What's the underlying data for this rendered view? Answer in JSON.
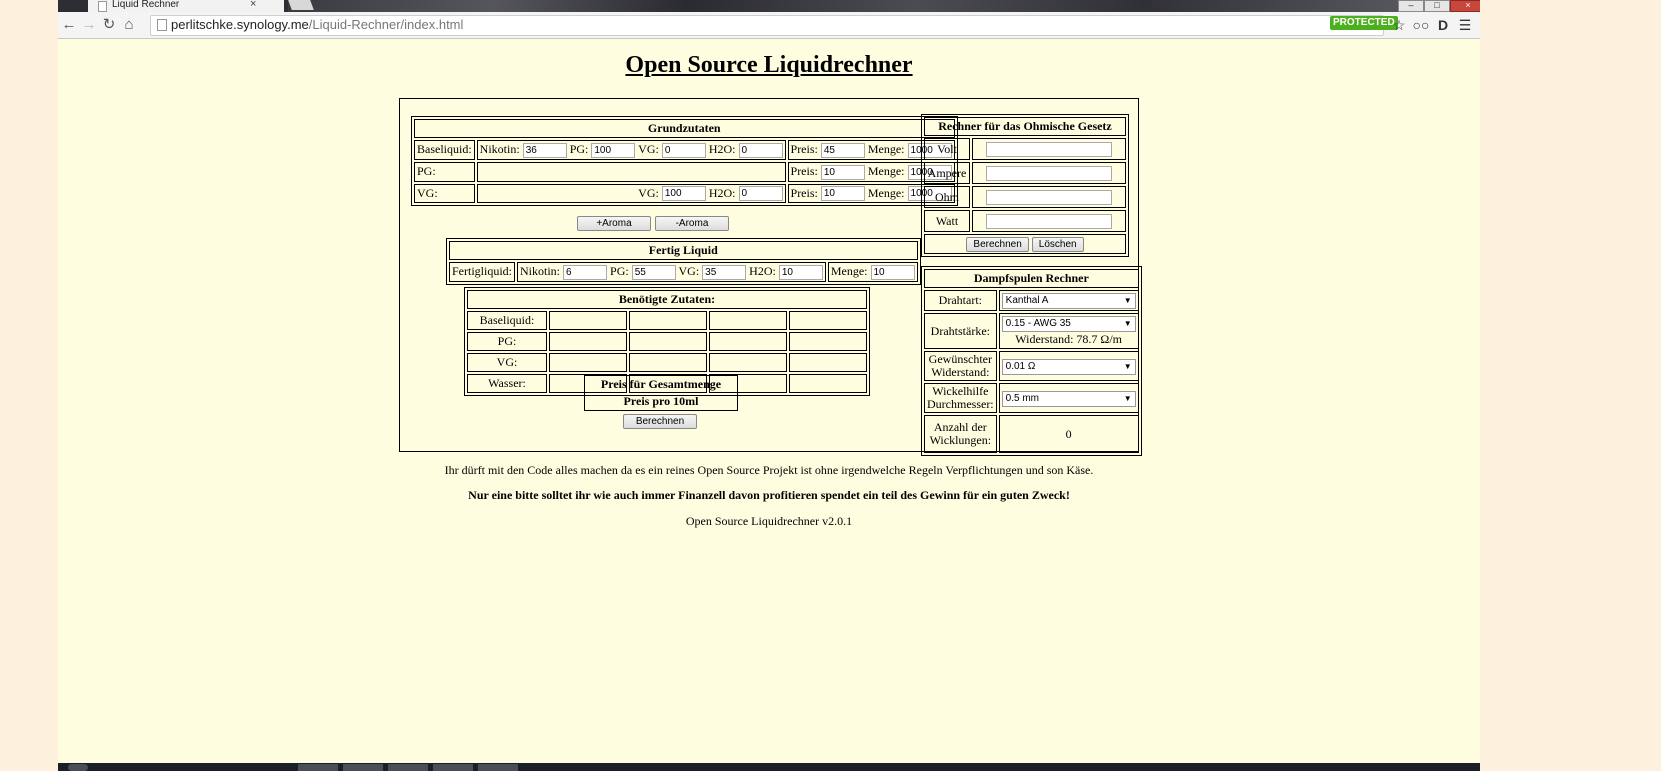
{
  "browser": {
    "tab_title": "Liquid Rechner",
    "tab_close": "×",
    "url_host": "perlitschke.synology.me",
    "url_path": "/Liquid-Rechner/index.html",
    "protected_badge": "PROTECTED",
    "window_buttons": {
      "minimize": "–",
      "maximize": "□",
      "close": "×"
    }
  },
  "page_title": "Open Source Liquidrechner",
  "grundzutaten": {
    "heading": "Grundzutaten",
    "rows": [
      {
        "label": "Baseliquid:",
        "nikotin_label": "Nikotin:",
        "nikotin": "36",
        "pg_label": "PG:",
        "pg": "100",
        "vg_label": "VG:",
        "vg": "0",
        "h2o_label": "H2O:",
        "h2o": "0",
        "preis_label": "Preis:",
        "preis": "45",
        "menge_label": "Menge:",
        "menge": "1000"
      },
      {
        "label": "PG:",
        "preis_label": "Preis:",
        "preis": "10",
        "menge_label": "Menge:",
        "menge": "1000"
      },
      {
        "label": "VG:",
        "vg_label": "VG:",
        "vg": "100",
        "h2o_label": "H2O:",
        "h2o": "0",
        "preis_label": "Preis:",
        "preis": "10",
        "menge_label": "Menge:",
        "menge": "1000"
      }
    ]
  },
  "aroma_buttons": {
    "add": "+Aroma",
    "remove": "-Aroma"
  },
  "fertig": {
    "heading": "Fertig Liquid",
    "label": "Fertigliquid:",
    "nikotin_label": "Nikotin:",
    "nikotin": "6",
    "pg_label": "PG:",
    "pg": "55",
    "vg_label": "VG:",
    "vg": "35",
    "h2o_label": "H2O:",
    "h2o": "10",
    "menge_label": "Menge:",
    "menge": "10"
  },
  "benoetigt": {
    "heading": "Benötigte Zutaten:",
    "rows": [
      "Baseliquid:",
      "PG:",
      "VG:",
      "Wasser:"
    ]
  },
  "preis": {
    "gesamt": "Preis für Gesamtmenge",
    "pro10": "Preis pro 10ml"
  },
  "berechnen": "Berechnen",
  "ohm": {
    "heading": "Rechner für das Ohmische Gesetz",
    "rows": [
      "Volt",
      "Ampere",
      "Ohm",
      "Watt"
    ],
    "berechnen": "Berechnen",
    "loeschen": "Löschen"
  },
  "dampf": {
    "heading": "Dampfspulen Rechner",
    "drahtart_label": "Drahtart:",
    "drahtart": "Kanthal A",
    "drahtstaerke_label": "Drahtstärke:",
    "drahtstaerke": "0.15 - AWG 35",
    "widerstand_text": "Widerstand: 78.7 Ω/m",
    "gewuenscht_label_1": "Gewünschter",
    "gewuenscht_label_2": "Widerstand:",
    "gewuenscht": "0.01 Ω",
    "wickel_label_1": "Wickelhilfe",
    "wickel_label_2": "Durchmesser:",
    "wickel": "0.5 mm",
    "anzahl_label_1": "Anzahl der",
    "anzahl_label_2": "Wicklungen:",
    "anzahl": "0"
  },
  "footer": {
    "line1": "Ihr dürft mit den Code alles machen da es ein reines Open Source Projekt ist ohne irgendwelche Regeln Verpflichtungen und son Käse.",
    "line2": "Nur eine bitte solltet ihr wie auch immer Finanzell davon profitieren spendet ein teil des Gewinn für ein guten Zweck!",
    "version": "Open Source Liquidrechner v2.0.1"
  }
}
